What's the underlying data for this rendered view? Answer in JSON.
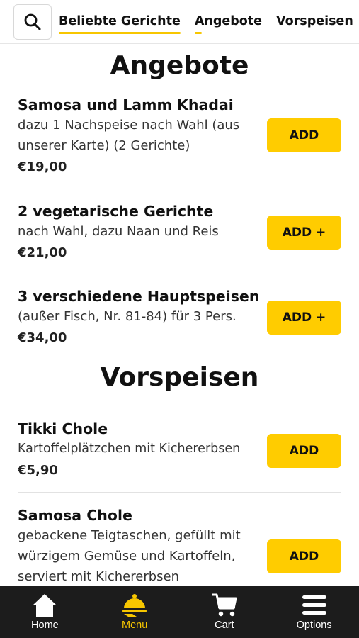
{
  "header": {
    "search_icon": "search-icon",
    "tabs": [
      {
        "label": "Beliebte Gerichte"
      },
      {
        "label": "Angebote"
      },
      {
        "label": "Vorspeisen"
      }
    ]
  },
  "sections": [
    {
      "title": "Angebote",
      "items": [
        {
          "name": "Samosa und Lamm Khadai",
          "desc": "dazu 1 Nachspeise nach Wahl (aus unserer Karte) (2 Gerichte)",
          "price": "€19,00",
          "button": "ADD"
        },
        {
          "name": "2 vegetarische Gerichte",
          "desc": "nach Wahl, dazu Naan und Reis",
          "price": "€21,00",
          "button": "ADD +"
        },
        {
          "name": "3 verschiedene Hauptspeisen",
          "desc": "(außer Fisch, Nr. 81-84) für 3 Pers.",
          "price": "€34,00",
          "button": "ADD +"
        }
      ]
    },
    {
      "title": "Vorspeisen",
      "items": [
        {
          "name": "Tikki Chole",
          "desc": "Kartoffelplätzchen mit Kichererbsen",
          "price": "€5,90",
          "button": "ADD"
        },
        {
          "name": "Samosa Chole",
          "desc": "gebackene Teigtaschen, gefüllt mit würzigem Gemüse und Kartoffeln, serviert mit Kichererbsen",
          "price": "",
          "button": "ADD"
        }
      ]
    }
  ],
  "bottom_nav": [
    {
      "label": "Home",
      "icon": "home-icon"
    },
    {
      "label": "Menu",
      "icon": "menu-cloche-icon"
    },
    {
      "label": "Cart",
      "icon": "cart-icon"
    },
    {
      "label": "Options",
      "icon": "hamburger-menu-icon"
    }
  ],
  "colors": {
    "accent": "#ffcc00",
    "nav_background": "#1c1c1c",
    "nav_active": "#f7c600"
  }
}
